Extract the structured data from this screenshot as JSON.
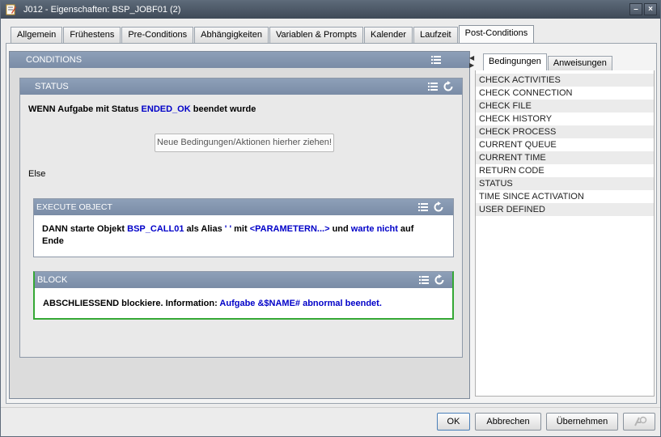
{
  "window": {
    "title": "J012 - Eigenschaften: BSP_JOBF01 (2)",
    "buttons": [
      "–",
      "×"
    ]
  },
  "tabs": [
    {
      "label": "Allgemein"
    },
    {
      "label": "Frühestens"
    },
    {
      "label": "Pre-Conditions"
    },
    {
      "label": "Abhängigkeiten"
    },
    {
      "label": "Variablen & Prompts"
    },
    {
      "label": "Kalender"
    },
    {
      "label": "Laufzeit"
    },
    {
      "label": "Post-Conditions",
      "active": true
    }
  ],
  "conditions": {
    "header": "CONDITIONS",
    "status": {
      "header": "STATUS",
      "line_prefix": "WENN Aufgabe mit Status ",
      "line_status": "ENDED_OK",
      "line_suffix": " beendet wurde",
      "drop_placeholder": "Neue Bedingungen/Aktionen hierher ziehen!",
      "else_label": "Else"
    },
    "execute": {
      "header": "EXECUTE OBJECT",
      "t1": "DANN starte Objekt ",
      "object": "BSP_CALL01",
      "t2": " als Alias ",
      "alias": "' '",
      "t3": " mit ",
      "params": "<PARAMETERN...>",
      "t4": " und ",
      "wait": "warte nicht",
      "t5": " auf Ende"
    },
    "block": {
      "header": "BLOCK",
      "t1": "ABSCHLIESSEND blockiere. Information: ",
      "info": "Aufgabe &$NAME# abnormal beendet."
    }
  },
  "right_panel": {
    "tabs": [
      "Bedingungen",
      "Anweisungen"
    ],
    "items": [
      "CHECK ACTIVITIES",
      "CHECK CONNECTION",
      "CHECK FILE",
      "CHECK HISTORY",
      "CHECK PROCESS",
      "CURRENT QUEUE",
      "CURRENT TIME",
      "RETURN CODE",
      "STATUS",
      "TIME SINCE ACTIVATION",
      "USER DEFINED"
    ]
  },
  "footer": {
    "ok": "OK",
    "cancel": "Abbrechen",
    "apply": "Übernehmen"
  }
}
